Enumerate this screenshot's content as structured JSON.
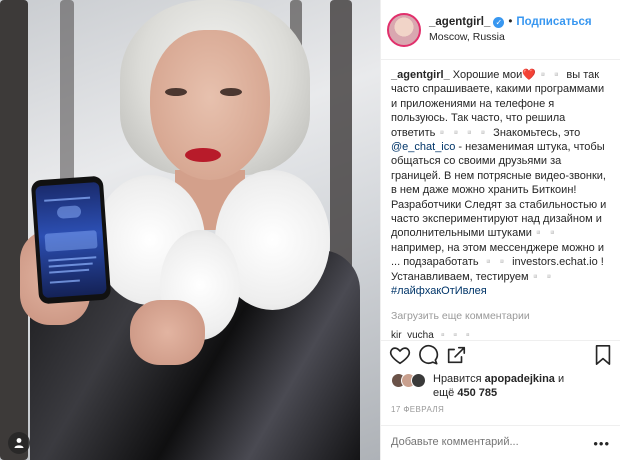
{
  "header": {
    "username": "_agentgirl_",
    "separator": "•",
    "follow_label": "Подписаться",
    "location": "Moscow, Russia",
    "verified_glyph": "✓"
  },
  "caption": {
    "username": "_agentgirl_",
    "part1": " Хорошие мои❤️▫️▫️ вы так часто спрашиваете, какими программами и приложениями на телефоне я пользуюсь. Так часто, что решила ответить▫️▫️▫️▫️ Знакомьтесь, это ",
    "mention": "@e_chat_ico",
    "part2": " - незаменимая штука, чтобы общаться со своими друзьями за границей. В нем потрясные видео-звонки, в нем даже можно хранить Биткоин! Разработчики Следят за стабильностью и часто экспериментируют над дизайном и дополнительными штуками▫️▫️ например, на этом мессенджере можно и ... подзаработать ▫️▫️ investors.echat.io ! Устанавливаем, тестируем▫️▫️ ",
    "hashtag": "#лайфхакОтИвлея"
  },
  "load_more": "Загрузить еще комментарии",
  "partial_comment": "kir_yucha ▫️▫️▫️",
  "actions": {
    "like_icon": "heart-icon",
    "comment_icon": "comment-bubble-icon",
    "share_icon": "share-icon",
    "save_icon": "bookmark-icon"
  },
  "likes": {
    "prefix": "Нравится ",
    "user": "apopadejkina",
    "middle": " и",
    "line2_prefix": "ещё ",
    "count": "450 785"
  },
  "date": "17 ФЕВРАЛЯ",
  "comment_placeholder": "Добавьте комментарий...",
  "more_options": "•••",
  "colors": {
    "link": "#3897f0",
    "mention": "#003569",
    "lips": "#b81b2a"
  }
}
